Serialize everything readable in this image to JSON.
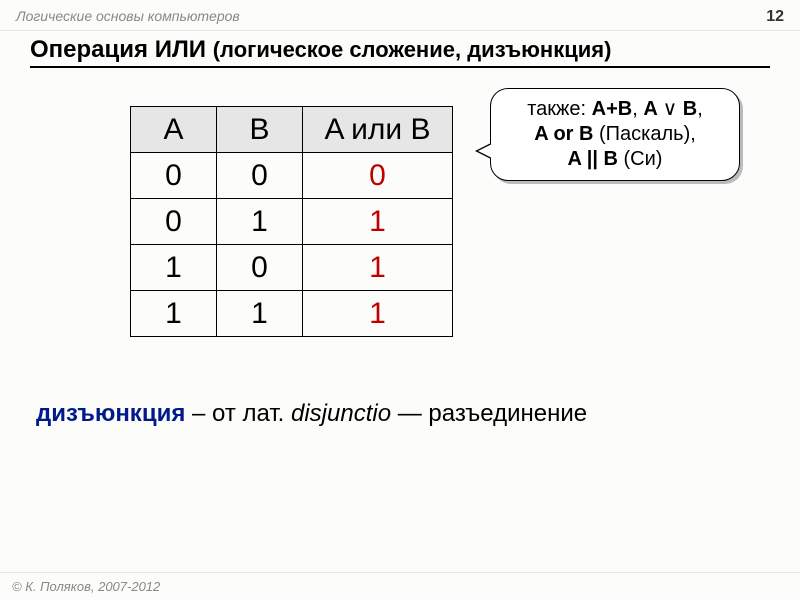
{
  "header": {
    "course": "Логические основы компьютеров",
    "page": "12"
  },
  "title": {
    "main": "Операция ИЛИ ",
    "sub": "(логическое сложение, дизъюнкция)"
  },
  "truth_table": {
    "headers": {
      "a": "A",
      "b": "B",
      "r": "A или B"
    },
    "rows": [
      {
        "a": "0",
        "b": "0",
        "r": "0"
      },
      {
        "a": "0",
        "b": "1",
        "r": "1"
      },
      {
        "a": "1",
        "b": "0",
        "r": "1"
      },
      {
        "a": "1",
        "b": "1",
        "r": "1"
      }
    ]
  },
  "callout": {
    "prefix": "также: ",
    "n1": "A+B",
    "sep1": ", ",
    "n2a": "A ",
    "n2_vee": "∨",
    "n2b": " B",
    "sep2": ",",
    "n3": "A or B",
    "n3_lang": " (Паскаль),",
    "n4": "A || B",
    "n4_lang": " (Си)"
  },
  "etym": {
    "term": "дизъюнкция",
    "mid": " – от лат. ",
    "lat": "disjunctio",
    "tail": " — разъединение"
  },
  "footer": {
    "copyright": "© К. Поляков, 2007-2012"
  }
}
